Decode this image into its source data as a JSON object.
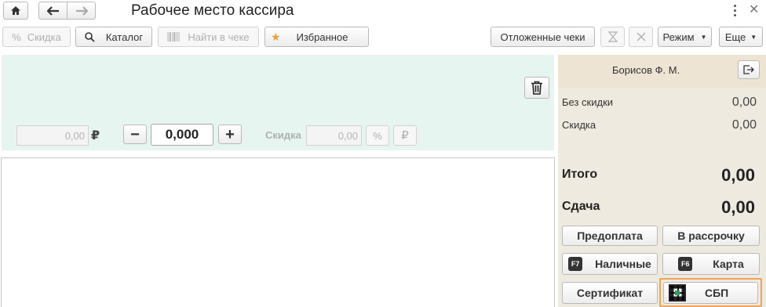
{
  "window": {
    "title": "Рабочее место кассира"
  },
  "toolbar": {
    "discount_label": "Скидка",
    "catalog_label": "Каталог",
    "find_in_receipt_label": "Найти в чеке",
    "favorites_label": "Избранное",
    "deferred_receipts_label": "Отложенные чеки",
    "mode_label": "Режим",
    "more_label": "Еще"
  },
  "item_editor": {
    "price_value": "0,00",
    "currency_symbol": "₽",
    "minus_symbol": "−",
    "quantity_value": "0,000",
    "plus_symbol": "+",
    "discount_label": "Скидка",
    "discount_value": "0,00",
    "percent_symbol": "%",
    "ruble_symbol": "₽"
  },
  "cashier": {
    "name": "Борисов Ф. М."
  },
  "totals": {
    "no_discount_label": "Без скидки",
    "no_discount_value": "0,00",
    "discount_label": "Скидка",
    "discount_value": "0,00",
    "total_label": "Итого",
    "total_value": "0,00",
    "change_label": "Сдача",
    "change_value": "0,00"
  },
  "payments": {
    "prepayment_label": "Предоплата",
    "installment_label": "В рассрочку",
    "cash_label": "Наличные",
    "cash_key": "F7",
    "card_label": "Карта",
    "card_key": "F6",
    "certificate_label": "Сертификат",
    "sbp_label": "СБП"
  },
  "colors": {
    "item_panel_bg": "#e6f5ef",
    "totals_panel_bg": "#efeae0",
    "sbp_highlight": "#f0a256"
  },
  "icons": [
    "home-icon",
    "back-arrow-icon",
    "forward-arrow-icon",
    "more-vertical-icon",
    "close-icon",
    "percent-icon",
    "search-icon",
    "barcode-icon",
    "star-icon",
    "hourglass-icon",
    "cross-icon",
    "dropdown-caret-icon",
    "trash-icon",
    "logout-icon",
    "qr-code-icon"
  ]
}
